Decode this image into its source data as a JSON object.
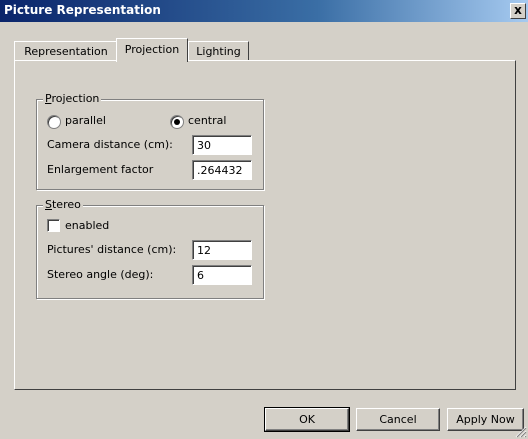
{
  "window": {
    "title": "Picture Representation",
    "close_glyph": "x"
  },
  "tabs": [
    {
      "label": "Representation"
    },
    {
      "label": "Projection"
    },
    {
      "label": "Lighting"
    }
  ],
  "projection": {
    "group_label_accel": "P",
    "group_label_rest": "rojection",
    "parallel_label": "parallel",
    "central_label": "central",
    "selected": "central",
    "camera_distance_label": "Camera distance (cm):",
    "camera_distance_value": "30",
    "enlargement_label": "Enlargement factor",
    "enlargement_value": ".264432"
  },
  "stereo": {
    "group_label_accel": "S",
    "group_label_rest": "tereo",
    "enabled_label": "enabled",
    "enabled_checked": false,
    "pictures_distance_label": "Pictures' distance (cm):",
    "pictures_distance_value": "12",
    "stereo_angle_label": "Stereo angle (deg):",
    "stereo_angle_value": "6"
  },
  "buttons": {
    "ok": "OK",
    "cancel": "Cancel",
    "apply": "Apply Now"
  }
}
